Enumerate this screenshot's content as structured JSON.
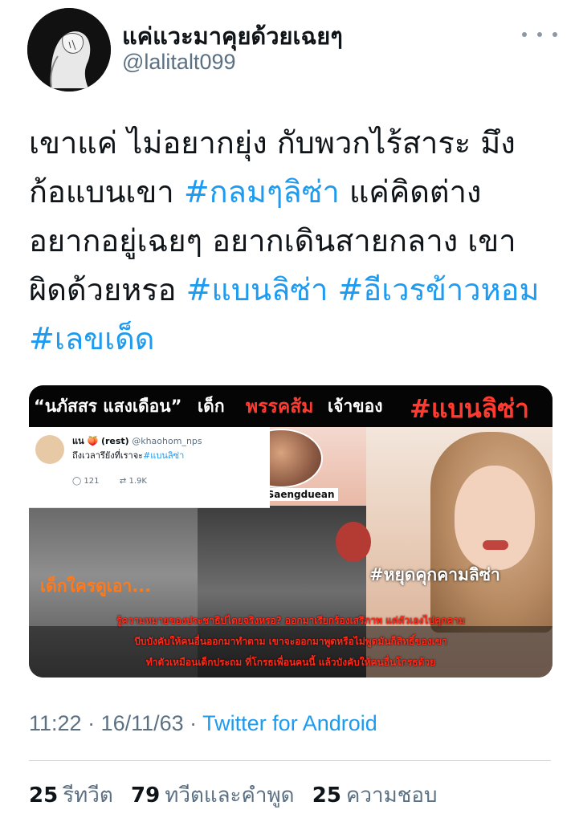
{
  "tweet": {
    "author": {
      "display_name": "แค่แวะมาคุยด้วยเฉยๆ",
      "handle": "@lalitalt099"
    },
    "text_plain_1": "เขาแค่ ไม่อยากยุ่ง กับพวกไร้สาระ มึง ก้อแบนเขา ",
    "hashtag_1": "#กลมๆลิซ่า",
    "text_plain_2": " แค่คิดต่าง อยากอยู่เฉยๆ อยากเดินสายกลาง เขา ผิดด้วยหรอ ",
    "hashtag_2": "#แบนลิซ่า",
    "text_plain_3": " ",
    "hashtag_3": "#อีเวรข้าวหอม",
    "text_plain_4": " ",
    "hashtag_4": "#เลขเด็ด",
    "media": {
      "banner_quote": "“นภัสสร แสงเดือน”",
      "banner_kid": "เด็ก",
      "banner_party": "พรรคส้ม",
      "banner_owner": "เจ้าของ",
      "banner_hashtag": "#แบนลิซ่า",
      "embed_name": "แน 🍑 (rest)",
      "embed_handle": "@khaohom_nps",
      "embed_text": "ถึงเวลารึยังที่เราจะ",
      "embed_hashtag": "#แบนลิซ่า",
      "embed_replies": "121",
      "embed_retweets": "1.9K",
      "caption_name": "Napatsorn Saengduean",
      "orange_label": "เด็กใครดูเอา...",
      "white_tag": "#หยุดคุกคามลิซ่า",
      "subtitle_1": "รู้ความหมายของประชาธิปไตยจริงหรอ? ออกมาเรียกร้องเสรีภาพ แต่ตัวเองไปคุกคาม",
      "subtitle_2": "บีบบังคับให้คนอื่นออกมาทำตาม เขาจะออกมาพูดหรือไม่พูดมันก็สิทธิ์ของเขา",
      "subtitle_3": "ทำตัวเหมือนเด็กประถม ที่โกรธเพื่อนคนนี้ แล้วบังคับให้คนอื่นโกรธด้วย"
    },
    "time": "11:22 · 16/11/63 · ",
    "source": "Twitter for Android",
    "stats": {
      "retweets_count": "25",
      "retweets_label": "รีทวีต",
      "quotes_count": "79",
      "quotes_label": "ทวีตและคำพูด",
      "likes_count": "25",
      "likes_label": "ความชอบ"
    }
  },
  "colors": {
    "link": "#1d9bf0",
    "secondary_text": "#5b7083",
    "primary_text": "#0f1419",
    "banner_red": "#ff3b30"
  },
  "icons": {
    "more": "more-horizontal-icon",
    "reply": "reply-icon",
    "retweet": "retweet-icon"
  }
}
